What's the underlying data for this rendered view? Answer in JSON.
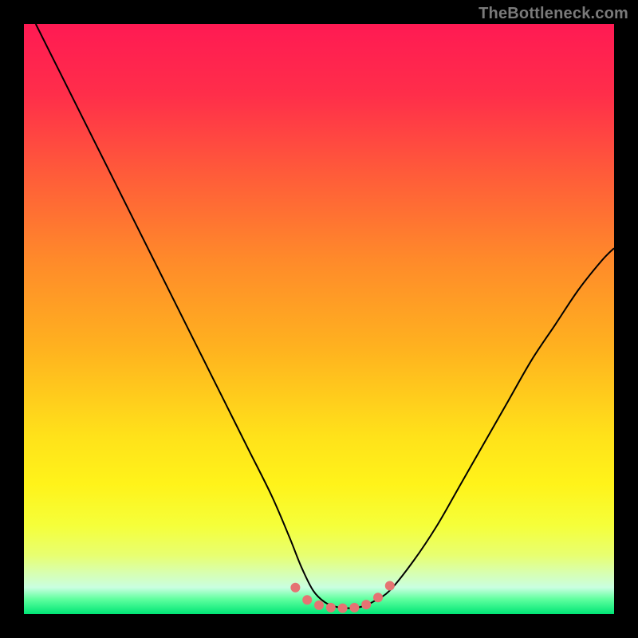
{
  "watermark": "TheBottleneck.com",
  "chart_data": {
    "type": "line",
    "title": "",
    "xlabel": "",
    "ylabel": "",
    "xlim": [
      0,
      100
    ],
    "ylim": [
      0,
      100
    ],
    "gradient_stops": [
      {
        "offset": 0.0,
        "color": "#ff1a53"
      },
      {
        "offset": 0.12,
        "color": "#ff2e4a"
      },
      {
        "offset": 0.25,
        "color": "#ff5a3a"
      },
      {
        "offset": 0.4,
        "color": "#ff8a2a"
      },
      {
        "offset": 0.55,
        "color": "#ffb21f"
      },
      {
        "offset": 0.7,
        "color": "#ffe21a"
      },
      {
        "offset": 0.78,
        "color": "#fff31a"
      },
      {
        "offset": 0.85,
        "color": "#f5ff3a"
      },
      {
        "offset": 0.9,
        "color": "#e8ff70"
      },
      {
        "offset": 0.93,
        "color": "#d8ffb0"
      },
      {
        "offset": 0.955,
        "color": "#c9ffe1"
      },
      {
        "offset": 0.975,
        "color": "#5eff9e"
      },
      {
        "offset": 1.0,
        "color": "#00e676"
      }
    ],
    "series": [
      {
        "name": "bottleneck-curve",
        "color": "#000000",
        "width": 2,
        "x": [
          2,
          6,
          10,
          14,
          18,
          22,
          26,
          30,
          34,
          38,
          42,
          45,
          47,
          49,
          51,
          53,
          55,
          57,
          59,
          62,
          66,
          70,
          74,
          78,
          82,
          86,
          90,
          94,
          98,
          100
        ],
        "y": [
          100,
          92,
          84,
          76,
          68,
          60,
          52,
          44,
          36,
          28,
          20,
          13,
          8,
          4,
          2,
          1.2,
          1,
          1.2,
          2,
          4,
          9,
          15,
          22,
          29,
          36,
          43,
          49,
          55,
          60,
          62
        ]
      }
    ],
    "marker_cluster": {
      "name": "minimum-markers",
      "color": "#e57373",
      "radius": 6,
      "points": [
        {
          "x": 46,
          "y": 4.5
        },
        {
          "x": 48,
          "y": 2.4
        },
        {
          "x": 50,
          "y": 1.5
        },
        {
          "x": 52,
          "y": 1.1
        },
        {
          "x": 54,
          "y": 1.0
        },
        {
          "x": 56,
          "y": 1.1
        },
        {
          "x": 58,
          "y": 1.6
        },
        {
          "x": 60,
          "y": 2.8
        },
        {
          "x": 62,
          "y": 4.8
        }
      ]
    }
  }
}
